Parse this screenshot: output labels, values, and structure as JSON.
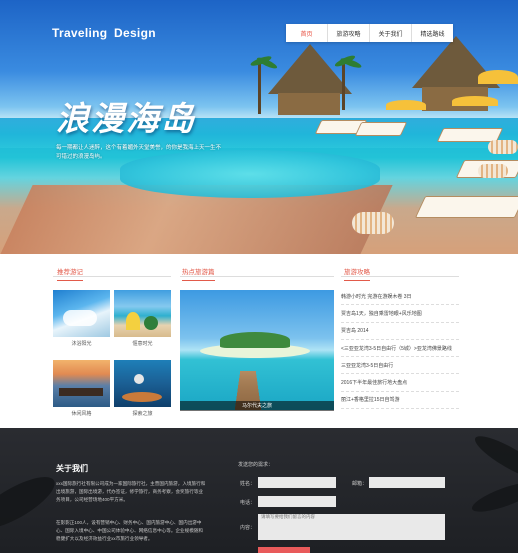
{
  "brand": "Traveling  Design",
  "nav": [
    "首页",
    "旅游攻略",
    "关于我们",
    "精选路线"
  ],
  "hero": {
    "headline": "浪漫海岛",
    "subtitle": "每一期都让人迷醉，这个有着媚外天堂美誉，的你是我海上天一生不可错过的浪漫岛屿。"
  },
  "sections": {
    "recommend": "推荐游记",
    "hot": "热点旅游篇",
    "guide": "旅游攻略"
  },
  "thumbs": [
    "沐浴阳光",
    "惬意时光",
    "休闲风格",
    "探索之旅"
  ],
  "feature_caption": "马尔代夫之旅",
  "guide_list": [
    "韩游小时光 完游在游娱木卷 3日",
    "贾吉岛1天，独自乘雷地眼+风乐地图",
    "贾吉岛  2014",
    "<三亚亚龙湾3-5日自由行（5城）>亚龙湾佛景路线",
    "三亚亚龙湾3-5日自由行",
    "2016下半年最佳旅行地大盘点",
    "丽江+香格里拉15日自驾游"
  ],
  "footer": {
    "about_title": "关于我们",
    "about_text_1": "xxx国际旅行社有限公司成为一家国际旅行社，主营国内旅游，入境旅行和出境旅游，国际出境游，代办签证，修学旅行，商务考察，会奖旅行等业务项目，公司经营场地400平方米。",
    "about_text_2": "在影影正100人，设有营销中心、财务中心、国内旅游中心、国内出游中心、国际入境中心、中国公司体验中心、网络信息中心等。企业规模随和稳健扩大以及经济效益行业xx市旅行业领导者。",
    "form_title": "发送您的需求：",
    "name_label": "姓名：",
    "email_label": "邮箱：",
    "phone_label": "电话：",
    "content_label": "内容：",
    "content_placeholder": "请填写要给我们留言的内容"
  }
}
